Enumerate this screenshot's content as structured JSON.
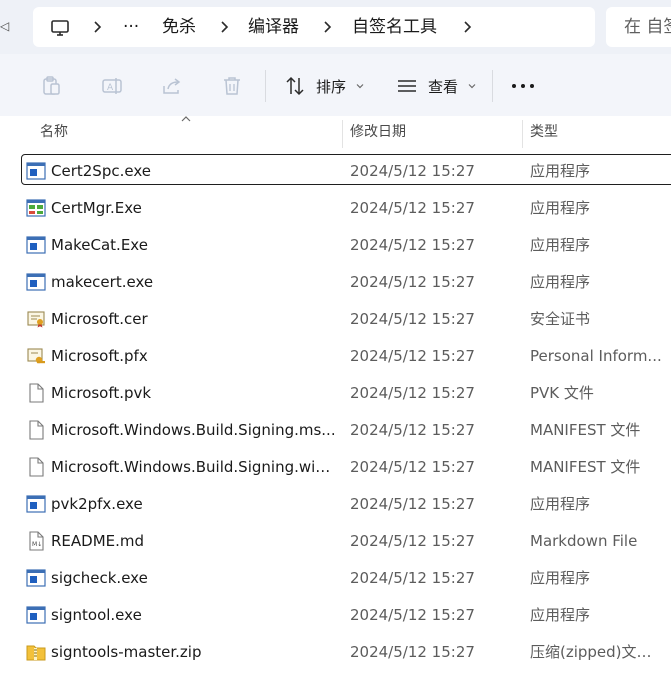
{
  "breadcrumb": {
    "items": [
      "免杀",
      "编译器",
      "自签名工具"
    ],
    "overflow": "···"
  },
  "search": {
    "placeholder": "在 自签名工具 中搜索"
  },
  "toolbar": {
    "sort_label": "排序",
    "view_label": "查看"
  },
  "columns": {
    "name": "名称",
    "date": "修改日期",
    "type": "类型"
  },
  "files": [
    {
      "name": "Cert2Spc.exe",
      "date": "2024/5/12 15:27",
      "type": "应用程序",
      "icon": "app-icon"
    },
    {
      "name": "CertMgr.Exe",
      "date": "2024/5/12 15:27",
      "type": "应用程序",
      "icon": "certmgr-icon"
    },
    {
      "name": "MakeCat.Exe",
      "date": "2024/5/12 15:27",
      "type": "应用程序",
      "icon": "app-icon"
    },
    {
      "name": "makecert.exe",
      "date": "2024/5/12 15:27",
      "type": "应用程序",
      "icon": "app-icon"
    },
    {
      "name": "Microsoft.cer",
      "date": "2024/5/12 15:27",
      "type": "安全证书",
      "icon": "certificate-icon"
    },
    {
      "name": "Microsoft.pfx",
      "date": "2024/5/12 15:27",
      "type": "Personal Inform...",
      "icon": "pfx-icon"
    },
    {
      "name": "Microsoft.pvk",
      "date": "2024/5/12 15:27",
      "type": "PVK 文件",
      "icon": "file-icon"
    },
    {
      "name": "Microsoft.Windows.Build.Signing.ms...",
      "date": "2024/5/12 15:27",
      "type": "MANIFEST 文件",
      "icon": "file-icon"
    },
    {
      "name": "Microsoft.Windows.Build.Signing.win...",
      "date": "2024/5/12 15:27",
      "type": "MANIFEST 文件",
      "icon": "file-icon"
    },
    {
      "name": "pvk2pfx.exe",
      "date": "2024/5/12 15:27",
      "type": "应用程序",
      "icon": "app-icon"
    },
    {
      "name": "README.md",
      "date": "2024/5/12 15:27",
      "type": "Markdown File",
      "icon": "markdown-icon"
    },
    {
      "name": "sigcheck.exe",
      "date": "2024/5/12 15:27",
      "type": "应用程序",
      "icon": "app-icon"
    },
    {
      "name": "signtool.exe",
      "date": "2024/5/12 15:27",
      "type": "应用程序",
      "icon": "app-icon"
    },
    {
      "name": "signtools-master.zip",
      "date": "2024/5/12 15:27",
      "type": "压缩(zipped)文件...",
      "icon": "zip-icon"
    }
  ],
  "colors": {
    "accent": "#1f5fbf",
    "address_bg": "#eef1f7",
    "toolbar_bg": "#f3f5fa"
  }
}
